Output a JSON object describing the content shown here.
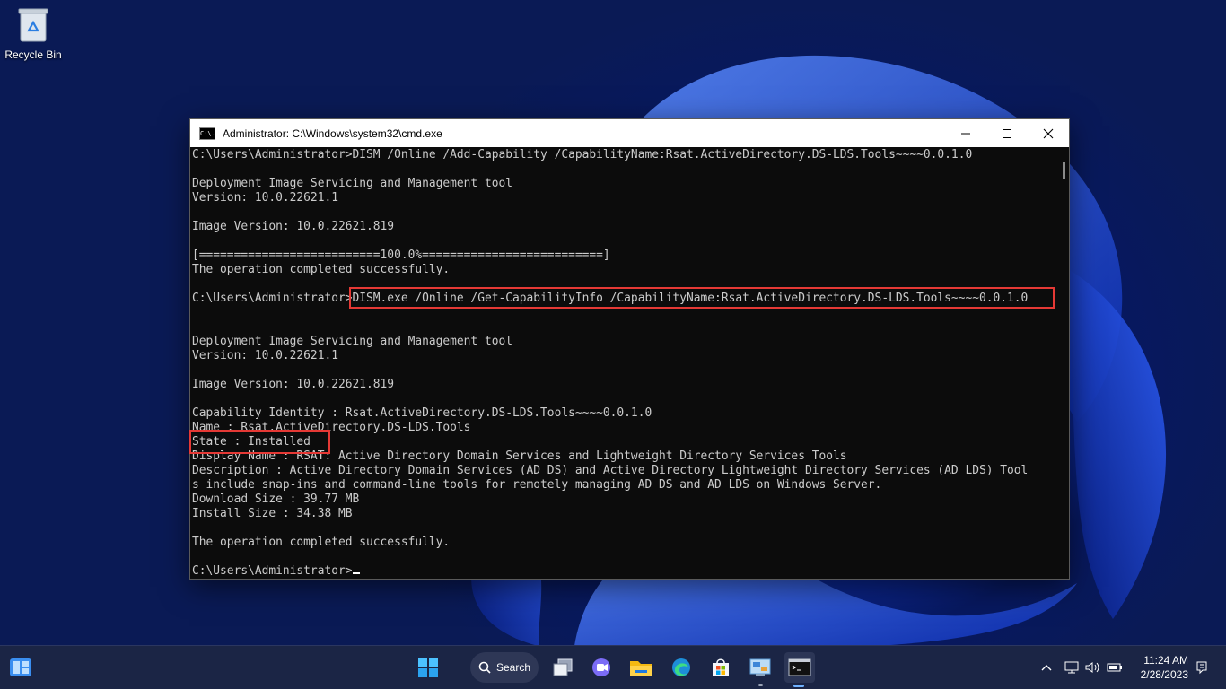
{
  "desktop": {
    "recycle_bin_label": "Recycle Bin"
  },
  "window": {
    "title": "Administrator: C:\\Windows\\system32\\cmd.exe",
    "icon_text": "C:\\."
  },
  "console_lines": [
    "C:\\Users\\Administrator>DISM /Online /Add-Capability /CapabilityName:Rsat.ActiveDirectory.DS-LDS.Tools~~~~0.0.1.0",
    "",
    "Deployment Image Servicing and Management tool",
    "Version: 10.0.22621.1",
    "",
    "Image Version: 10.0.22621.819",
    "",
    "[==========================100.0%==========================]",
    "The operation completed successfully.",
    "",
    "C:\\Users\\Administrator>DISM.exe /Online /Get-CapabilityInfo /CapabilityName:Rsat.ActiveDirectory.DS-LDS.Tools~~~~0.0.1.0",
    "",
    "",
    "Deployment Image Servicing and Management tool",
    "Version: 10.0.22621.1",
    "",
    "Image Version: 10.0.22621.819",
    "",
    "Capability Identity : Rsat.ActiveDirectory.DS-LDS.Tools~~~~0.0.1.0",
    "Name : Rsat.ActiveDirectory.DS-LDS.Tools",
    "State : Installed",
    "Display Name : RSAT: Active Directory Domain Services and Lightweight Directory Services Tools",
    "Description : Active Directory Domain Services (AD DS) and Active Directory Lightweight Directory Services (AD LDS) Tool",
    "s include snap-ins and command-line tools for remotely managing AD DS and AD LDS on Windows Server.",
    "Download Size : 39.77 MB",
    "Install Size : 34.38 MB",
    "",
    "The operation completed successfully.",
    "",
    "C:\\Users\\Administrator>"
  ],
  "taskbar": {
    "search_label": "Search",
    "time": "11:24 AM",
    "date": "2/28/2023"
  },
  "colors": {
    "highlight": "#e53935",
    "taskbar": "#1b2545",
    "console_text": "#cccccc"
  },
  "icons": [
    "recycle-bin-icon",
    "widgets-icon",
    "start-icon",
    "search-icon",
    "task-view-icon",
    "teams-chat-icon",
    "file-explorer-icon",
    "edge-icon",
    "store-icon",
    "control-panel-icon",
    "terminal-icon",
    "chevron-up-icon",
    "network-icon",
    "volume-icon",
    "battery-icon",
    "notification-icon"
  ]
}
